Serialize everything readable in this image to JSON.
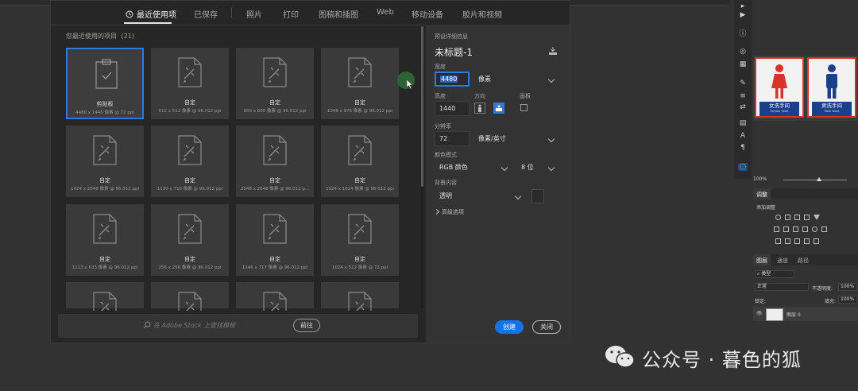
{
  "dialog": {
    "tabs": [
      {
        "label": "最近使用项",
        "active": true
      },
      {
        "label": "已保存"
      },
      {
        "label": "照片"
      },
      {
        "label": "打印"
      },
      {
        "label": "图稿和插图"
      },
      {
        "label": "Web"
      },
      {
        "label": "移动设备"
      },
      {
        "label": "胶片和视频"
      }
    ],
    "section_title": "您最近使用的项目",
    "section_count": "(21)",
    "items": [
      {
        "name": "剪贴板",
        "size": "4480 x 1440 像素 @ 72 ppi",
        "icon": "clipboard-icon",
        "selected": true
      },
      {
        "name": "自定",
        "size": "512 x 512 像素 @ 96.012 ppi",
        "icon": "custom-doc-icon"
      },
      {
        "name": "自定",
        "size": "900 x 600 像素 @ 96.012 ppi",
        "icon": "custom-doc-icon"
      },
      {
        "name": "自定",
        "size": "1048 x 976 像素 @ 96.012 ppi",
        "icon": "custom-doc-icon"
      },
      {
        "name": "自定",
        "size": "1024 x 2048 像素 @ 96.012 ppi",
        "icon": "custom-doc-icon"
      },
      {
        "name": "自定",
        "size": "1130 x 716 像素 @ 96.012 ppi",
        "icon": "custom-doc-icon"
      },
      {
        "name": "自定",
        "size": "2048 x 2048 像素 @ 96.012 p...",
        "icon": "custom-doc-icon"
      },
      {
        "name": "自定",
        "size": "1024 x 1024 像素 @ 96.012 ppi",
        "icon": "custom-doc-icon"
      },
      {
        "name": "自定",
        "size": "1113 x 633 像素 @ 96.012 ppi",
        "icon": "custom-doc-icon"
      },
      {
        "name": "自定",
        "size": "256 x 256 像素 @ 96.012 ppi",
        "icon": "custom-doc-icon"
      },
      {
        "name": "自定",
        "size": "1146 x 717 像素 @ 96.012 ppi",
        "icon": "custom-doc-icon"
      },
      {
        "name": "自定",
        "size": "1024 x 512 像素 @ 72 ppi",
        "icon": "custom-doc-icon"
      },
      {
        "name": "",
        "size": "",
        "icon": "custom-doc-icon"
      },
      {
        "name": "",
        "size": "",
        "icon": "custom-doc-icon"
      },
      {
        "name": "",
        "size": "",
        "icon": "custom-doc-icon"
      },
      {
        "name": "",
        "size": "",
        "icon": "custom-doc-icon"
      }
    ],
    "stock_placeholder": "在 Adobe Stock 上查找模板",
    "go_label": "前往",
    "details": {
      "section_label": "预设详细信息",
      "doc_name": "未标题-1",
      "width_label": "宽度",
      "width_value": "4480",
      "width_unit": "像素",
      "height_label": "高度",
      "height_value": "1440",
      "orientation_label": "方向",
      "artboard_label": "画板",
      "resolution_label": "分辨率",
      "resolution_value": "72",
      "resolution_unit": "像素/英寸",
      "color_mode_label": "颜色模式",
      "color_mode_value": "RGB 颜色",
      "bit_depth_value": "8 位",
      "background_label": "背景内容",
      "background_value": "透明",
      "advanced_label": "高级选项"
    },
    "create_label": "创建",
    "close_label": "关闭"
  },
  "right_panels": {
    "signs": [
      {
        "caption": "女洗手间",
        "sub": "Female Toilet",
        "figure_color": "#d9322a"
      },
      {
        "caption": "男洗手间",
        "sub": "Male Toilet",
        "figure_color": "#1b3f8b"
      }
    ],
    "zoom_left": "100%",
    "zoom_right": "100%",
    "adjust_tab": "调整",
    "add_adjust": "添加调整",
    "layer_tabs": [
      "图层",
      "通道",
      "路径"
    ],
    "kind_filter": "类型",
    "blend_mode": "正常",
    "opacity_label": "不透明度:",
    "opacity_value": "100%",
    "lock_label": "锁定:",
    "fill_label": "填充:",
    "fill_value": "100%",
    "layer_name": "图层 0"
  },
  "watermark": {
    "text": "公众号 · 暮色的狐"
  },
  "colors": {
    "accent": "#2e7be0",
    "create_button": "#1473e6"
  }
}
